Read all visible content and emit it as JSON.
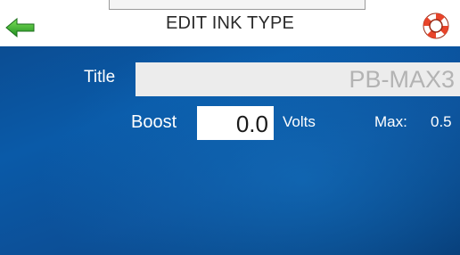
{
  "header": {
    "title": "EDIT INK TYPE",
    "back_icon": "green-left-arrow",
    "help_icon": "lifebuoy-icon"
  },
  "form": {
    "title_label": "Title",
    "title_value": "PB-MAX3",
    "boost_label": "Boost",
    "boost_value": "0.0",
    "boost_unit": "Volts",
    "max_label": "Max:",
    "max_value": "0.5"
  },
  "colors": {
    "background": "#0b4d93",
    "accent_green": "#2db52d",
    "help_red": "#e8442a"
  }
}
